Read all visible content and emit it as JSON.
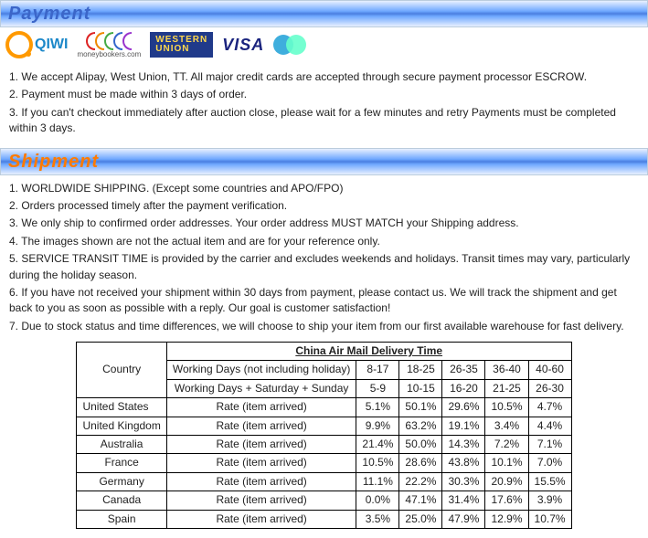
{
  "payment": {
    "heading": "Payment",
    "logos": {
      "qiwi": "QIWI",
      "mb_sub": "moneybookers.com",
      "wu_l1": "WESTERN",
      "wu_l2": "UNION",
      "visa": "VISA"
    },
    "items": [
      "1. We accept Alipay, West Union, TT. All major credit cards are accepted through secure payment processor ESCROW.",
      "2. Payment must be made within 3 days of order.",
      "3. If you can't checkout immediately after auction close, please wait for a few minutes and retry Payments must be completed within 3 days."
    ]
  },
  "shipment": {
    "heading": "Shipment",
    "items": [
      "1. WORLDWIDE SHIPPING. (Except some countries and APO/FPO)",
      "2. Orders processed timely after the payment verification.",
      "3. We only ship to confirmed order addresses. Your order address MUST MATCH your Shipping address.",
      "4. The images shown are not the actual item and are for your reference only.",
      "5. SERVICE TRANSIT TIME is provided by the carrier and excludes weekends and holidays. Transit times may vary, particularly during the holiday season.",
      "6. If you have not received your shipment within 30 days from payment, please contact us. We will track the shipment and get back to you as soon as possible with a reply. Our goal is customer satisfaction!",
      "7. Due to stock status and time differences, we will choose to ship your item from our first available warehouse for fast delivery."
    ]
  },
  "chart_data": {
    "type": "table",
    "title": "China Air Mail Delivery Time",
    "country_header": "Country",
    "wd_no_holiday_label": "Working Days (not including holiday)",
    "wd_sat_sun_label": "Working Days + Saturday + Sunday",
    "rate_label": "Rate (item arrived)",
    "ranges_wd": [
      "8-17",
      "18-25",
      "26-35",
      "36-40",
      "40-60"
    ],
    "ranges_full": [
      "5-9",
      "10-15",
      "16-20",
      "21-25",
      "26-30"
    ],
    "rows": [
      {
        "country": "United States",
        "rates": [
          "5.1%",
          "50.1%",
          "29.6%",
          "10.5%",
          "4.7%"
        ]
      },
      {
        "country": "United Kingdom",
        "rates": [
          "9.9%",
          "63.2%",
          "19.1%",
          "3.4%",
          "4.4%"
        ]
      },
      {
        "country": "Australia",
        "rates": [
          "21.4%",
          "50.0%",
          "14.3%",
          "7.2%",
          "7.1%"
        ]
      },
      {
        "country": "France",
        "rates": [
          "10.5%",
          "28.6%",
          "43.8%",
          "10.1%",
          "7.0%"
        ]
      },
      {
        "country": "Germany",
        "rates": [
          "11.1%",
          "22.2%",
          "30.3%",
          "20.9%",
          "15.5%"
        ]
      },
      {
        "country": "Canada",
        "rates": [
          "0.0%",
          "47.1%",
          "31.4%",
          "17.6%",
          "3.9%"
        ]
      },
      {
        "country": "Spain",
        "rates": [
          "3.5%",
          "25.0%",
          "47.9%",
          "12.9%",
          "10.7%"
        ]
      }
    ]
  }
}
